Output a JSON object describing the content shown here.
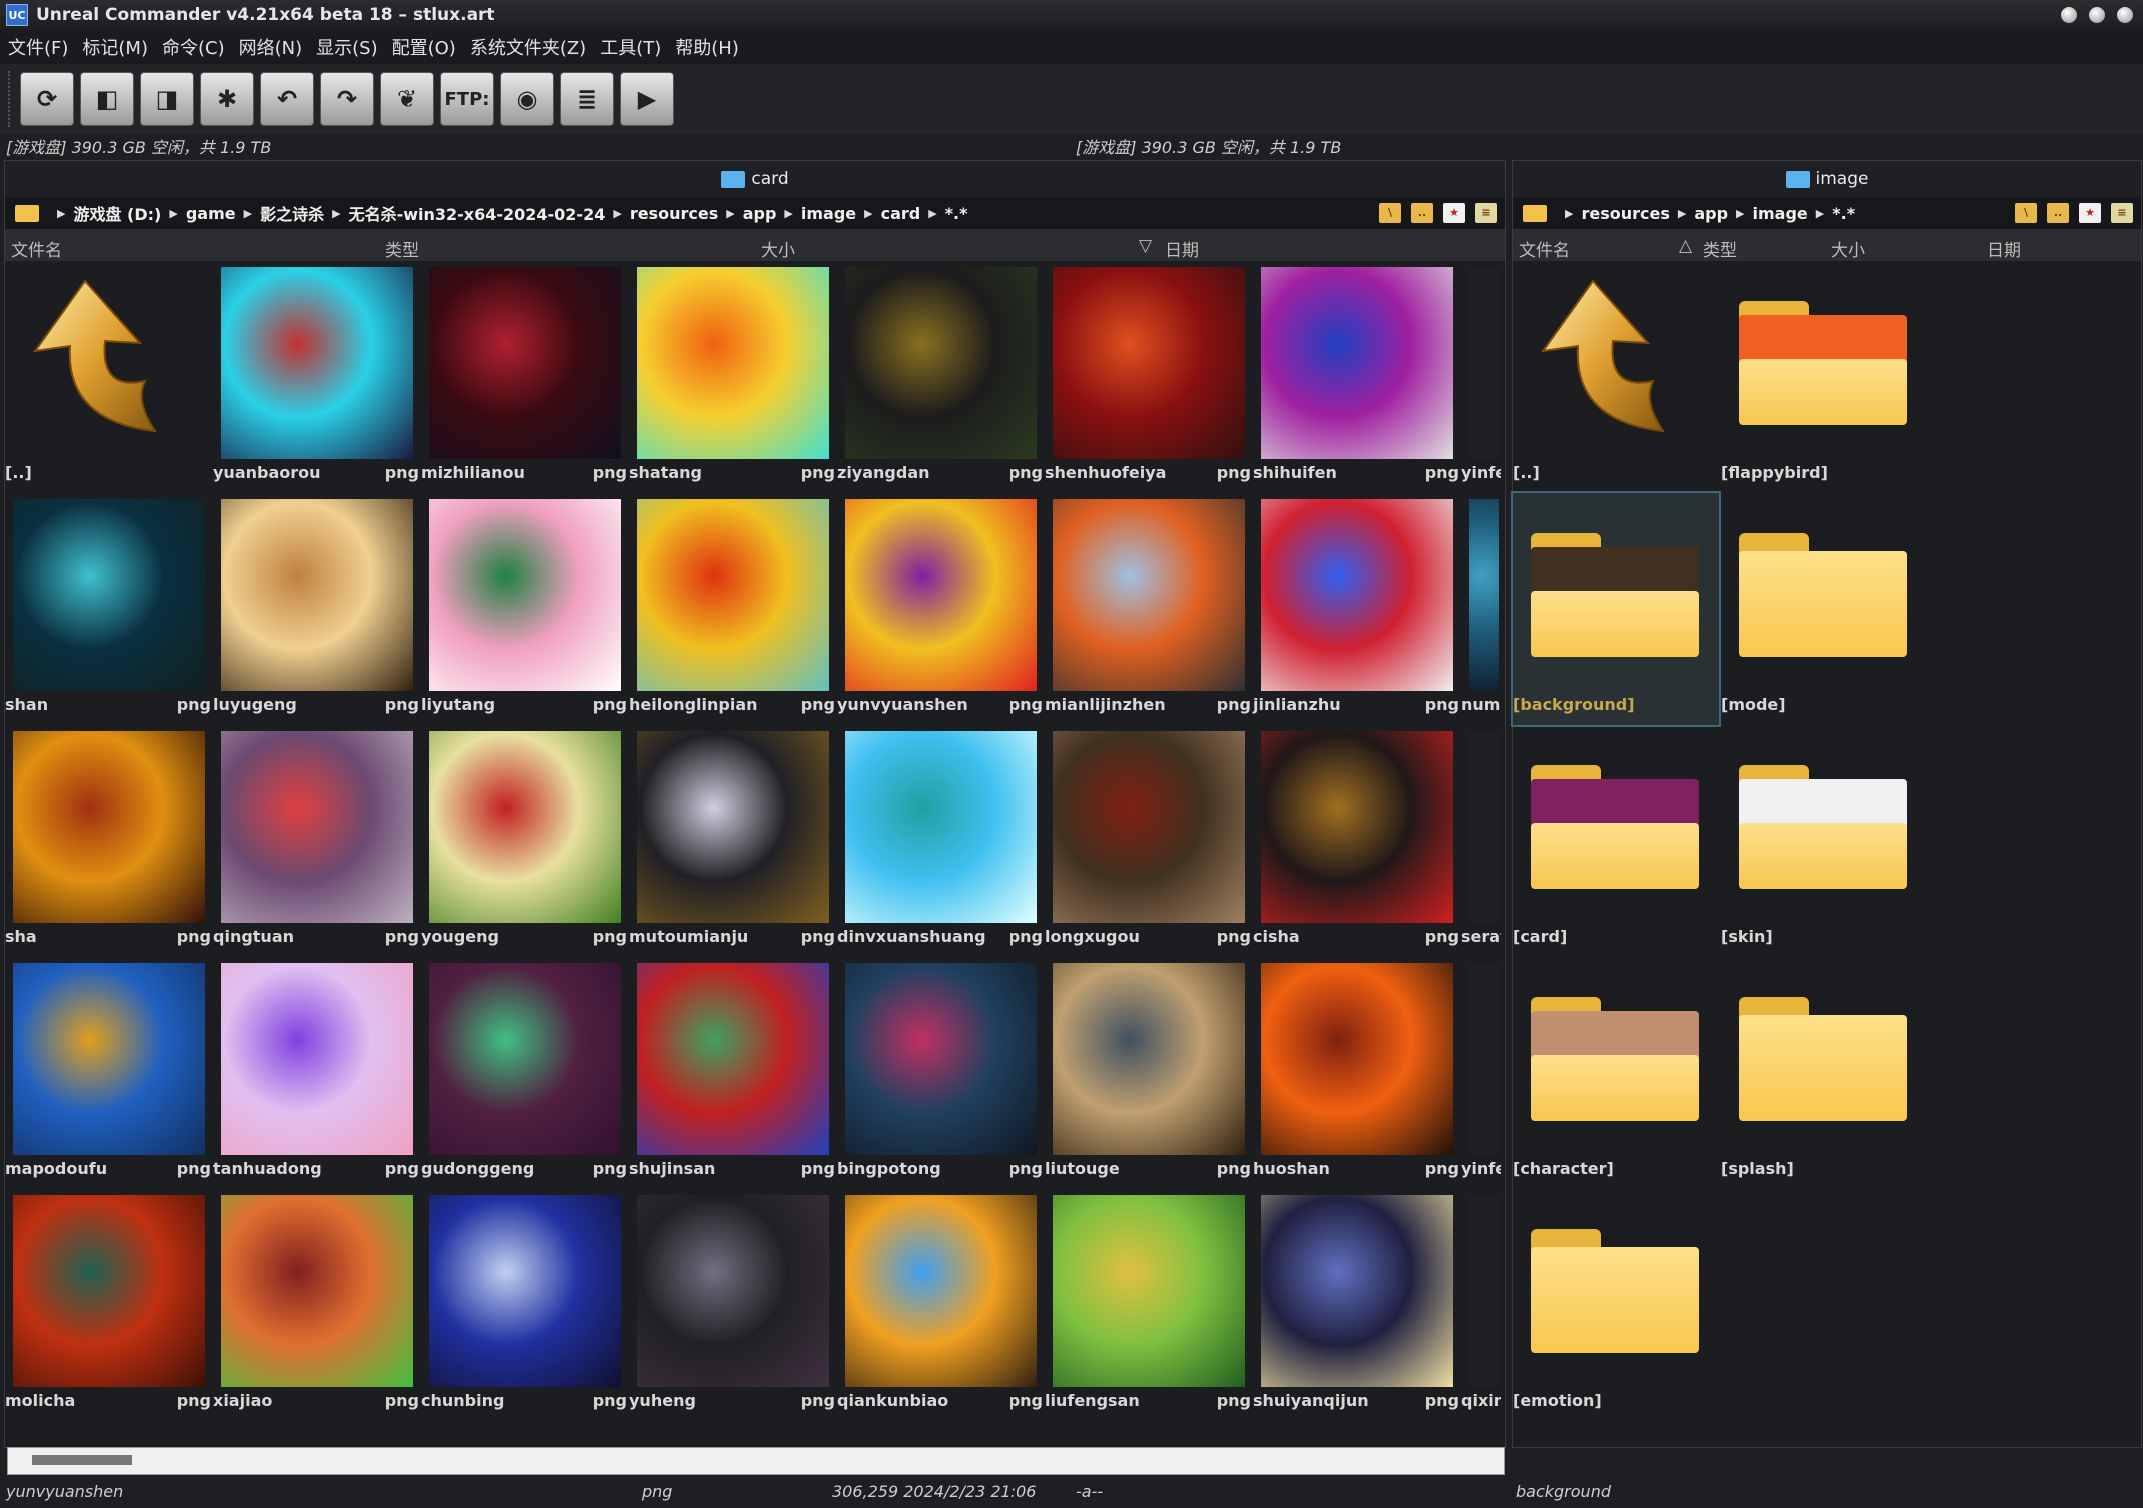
{
  "window": {
    "title": "Unreal Commander v4.21x64 beta 18 – stlux.art"
  },
  "menu": [
    "文件(F)",
    "标记(M)",
    "命令(C)",
    "网络(N)",
    "显示(S)",
    "配置(O)",
    "系统文件夹(Z)",
    "工具(T)",
    "帮助(H)"
  ],
  "toolbar": {
    "ftp_label": "FTP:"
  },
  "drives": {
    "left": "[游戏盘]  390.3 GB 空闲，共 1.9 TB",
    "right": "[游戏盘]  390.3 GB 空闲，共 1.9 TB"
  },
  "left_panel": {
    "title": "card",
    "path": [
      "游戏盘 (D:)",
      "game",
      "影之诗杀",
      "无名杀-win32-x64-2024-02-24",
      "resources",
      "app",
      "image",
      "card",
      "*.*"
    ],
    "columns": {
      "name": "文件名",
      "type": "类型",
      "size": "大小",
      "date": "日期"
    },
    "parent": "[..]",
    "files": [
      {
        "name": "yuanbaorou",
        "ext": "png",
        "colors": [
          "#2ad1e8",
          "#c23030",
          "#1a1a40"
        ]
      },
      {
        "name": "mizhilianou",
        "ext": "png",
        "colors": [
          "#3a0a10",
          "#b02030",
          "#101020"
        ]
      },
      {
        "name": "shatang",
        "ext": "png",
        "colors": [
          "#f6d030",
          "#f06010",
          "#40e0d0"
        ]
      },
      {
        "name": "ziyangdan",
        "ext": "png",
        "colors": [
          "#1c1c1c",
          "#8a7020",
          "#2a3a20"
        ]
      },
      {
        "name": "shenhuofeiya",
        "ext": "png",
        "colors": [
          "#8a1010",
          "#e05020",
          "#301010"
        ]
      },
      {
        "name": "shihuifen",
        "ext": "png",
        "colors": [
          "#a020a0",
          "#2040c0",
          "#e0e0e0"
        ]
      },
      {
        "name": "yinfe",
        "ext": "",
        "colors": [
          "#202024",
          "#202024",
          "#202024"
        ]
      },
      {
        "name": "shan",
        "ext": "png",
        "colors": [
          "#0a3040",
          "#40c0d0",
          "#102020"
        ]
      },
      {
        "name": "luyugeng",
        "ext": "png",
        "colors": [
          "#f0d090",
          "#c08040",
          "#302010"
        ]
      },
      {
        "name": "liyutang",
        "ext": "png",
        "colors": [
          "#f0a0c0",
          "#208040",
          "#ffffff"
        ]
      },
      {
        "name": "heilonglinpian",
        "ext": "png",
        "colors": [
          "#f0c020",
          "#e03010",
          "#60c0c0"
        ]
      },
      {
        "name": "yunvyuanshen",
        "ext": "png",
        "colors": [
          "#f0c020",
          "#8020a0",
          "#e02020"
        ]
      },
      {
        "name": "mianlijinzhen",
        "ext": "png",
        "colors": [
          "#e06020",
          "#a0c0e0",
          "#303030"
        ]
      },
      {
        "name": "jinlianzhu",
        "ext": "png",
        "colors": [
          "#d02030",
          "#3060f0",
          "#f0f0f0"
        ]
      },
      {
        "name": "numa",
        "ext": "",
        "colors": [
          "#206080",
          "#40a0c0",
          "#102030"
        ]
      },
      {
        "name": "sha",
        "ext": "png",
        "colors": [
          "#e09010",
          "#a03010",
          "#301008"
        ]
      },
      {
        "name": "qingtuan",
        "ext": "png",
        "colors": [
          "#6a4a70",
          "#e04040",
          "#c0b0c0"
        ]
      },
      {
        "name": "yougeng",
        "ext": "png",
        "colors": [
          "#e8e0a0",
          "#c02020",
          "#408020"
        ]
      },
      {
        "name": "mutoumianju",
        "ext": "png",
        "colors": [
          "#202024",
          "#d0d0e0",
          "#806020"
        ]
      },
      {
        "name": "dinvxuanshuang",
        "ext": "png",
        "colors": [
          "#40c0f0",
          "#20a0a0",
          "#e0ffff"
        ]
      },
      {
        "name": "longxugou",
        "ext": "png",
        "colors": [
          "#403020",
          "#802010",
          "#a08060"
        ]
      },
      {
        "name": "cisha",
        "ext": "png",
        "colors": [
          "#201818",
          "#a07020",
          "#d02020"
        ]
      },
      {
        "name": "serafi",
        "ext": "",
        "colors": [
          "#202024",
          "#202024",
          "#202024"
        ]
      },
      {
        "name": "mapodoufu",
        "ext": "png",
        "colors": [
          "#2060c0",
          "#e0a020",
          "#103060"
        ]
      },
      {
        "name": "tanhuadong",
        "ext": "png",
        "colors": [
          "#e0c0f0",
          "#8040e0",
          "#f0a0c0"
        ]
      },
      {
        "name": "gudonggeng",
        "ext": "png",
        "colors": [
          "#502040",
          "#40c080",
          "#301030"
        ]
      },
      {
        "name": "shujinsan",
        "ext": "png",
        "colors": [
          "#c02020",
          "#40a060",
          "#2040c0"
        ]
      },
      {
        "name": "bingpotong",
        "ext": "png",
        "colors": [
          "#204060",
          "#c03060",
          "#101820"
        ]
      },
      {
        "name": "liutouge",
        "ext": "png",
        "colors": [
          "#c0a070",
          "#405060",
          "#302010"
        ]
      },
      {
        "name": "huoshan",
        "ext": "png",
        "colors": [
          "#f06010",
          "#802010",
          "#201008"
        ]
      },
      {
        "name": "yinfe",
        "ext": "",
        "colors": [
          "#202024",
          "#202024",
          "#202024"
        ]
      },
      {
        "name": "molicha",
        "ext": "png",
        "colors": [
          "#c03010",
          "#206050",
          "#401008"
        ]
      },
      {
        "name": "xiajiao",
        "ext": "png",
        "colors": [
          "#e07030",
          "#802020",
          "#40c040"
        ]
      },
      {
        "name": "chunbing",
        "ext": "png",
        "colors": [
          "#2030a0",
          "#c0d0f0",
          "#101030"
        ]
      },
      {
        "name": "yuheng",
        "ext": "png",
        "colors": [
          "#202024",
          "#707080",
          "#403040"
        ]
      },
      {
        "name": "qiankunbiao",
        "ext": "png",
        "colors": [
          "#f0a020",
          "#40a0f0",
          "#302010"
        ]
      },
      {
        "name": "liufengsan",
        "ext": "png",
        "colors": [
          "#80c040",
          "#e0c040",
          "#206020"
        ]
      },
      {
        "name": "shuiyanqijun",
        "ext": "png",
        "colors": [
          "#202040",
          "#6070c0",
          "#f0e0a0"
        ]
      },
      {
        "name": "qixin",
        "ext": "",
        "colors": [
          "#202024",
          "#202024",
          "#202024"
        ]
      }
    ]
  },
  "right_panel": {
    "title": "image",
    "path": [
      "resources",
      "app",
      "image",
      "*.*"
    ],
    "columns": {
      "name": "文件名",
      "type": "类型",
      "size": "大小",
      "date": "日期"
    },
    "parent": "[..]",
    "folders": [
      {
        "name": "[flappybird]",
        "preview": "#f06020"
      },
      {
        "name": "[background]",
        "preview": "#403020"
      },
      {
        "name": "[mode]",
        "preview": ""
      },
      {
        "name": "[card]",
        "preview": "#802060"
      },
      {
        "name": "[skin]",
        "preview": "#f0f0f0"
      },
      {
        "name": "[character]",
        "preview": "#c09070"
      },
      {
        "name": "[splash]",
        "preview": ""
      },
      {
        "name": "[emotion]",
        "preview": ""
      }
    ]
  },
  "status": {
    "left_name": "yunvyuanshen",
    "left_ext": "png",
    "left_size_date": "306,259  2024/2/23 21:06",
    "left_attr": "-a--",
    "right_name": "background"
  }
}
